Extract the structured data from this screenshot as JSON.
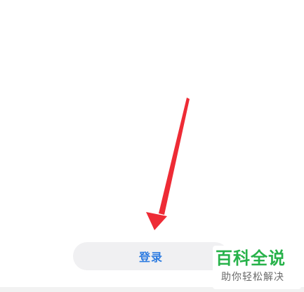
{
  "login": {
    "label": "登录"
  },
  "watermark": {
    "title": "百科全说",
    "subtitle": "助你轻松解决"
  },
  "colors": {
    "accent": "#2f7de1",
    "arrow": "#ee2b35",
    "watermark": "#27b24a"
  },
  "annotation": {
    "icon": "red-arrow-icon"
  }
}
